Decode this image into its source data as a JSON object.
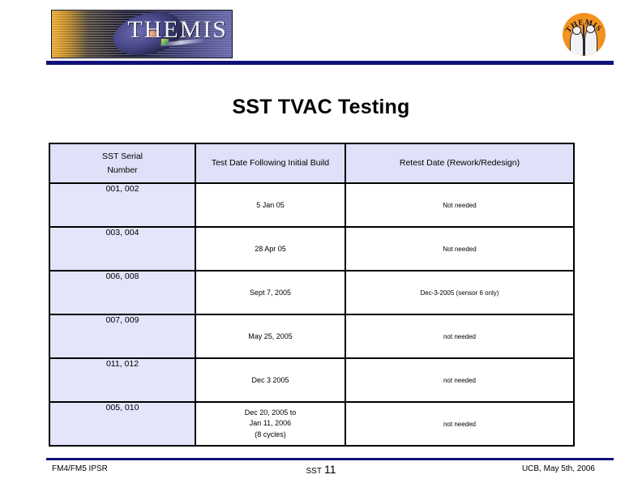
{
  "header": {
    "banner_wordmark": "THEMIS",
    "seal_text": "THEMIS"
  },
  "title": "SST TVAC Testing",
  "table": {
    "columns": [
      "SST Serial\nNumber",
      "Test Date Following Initial Build",
      "Retest Date (Rework/Redesign)"
    ],
    "header_serial_line1": "SST Serial",
    "header_serial_line2": "Number",
    "header_test": "Test Date Following Initial Build",
    "header_retest": "Retest Date (Rework/Redesign)",
    "rows": [
      {
        "serial": "001, 002",
        "test_date": "5 Jan 05",
        "retest_date": "Not needed"
      },
      {
        "serial": "003, 004",
        "test_date": "28 Apr 05",
        "retest_date": "Not needed"
      },
      {
        "serial": "006, 008",
        "test_date": "Sept 7,  2005",
        "retest_date": "Dec-3-2005 (sensor 6 only)"
      },
      {
        "serial": "007, 009",
        "test_date": "May 25, 2005",
        "retest_date": "not needed"
      },
      {
        "serial": "011, 012",
        "test_date": "Dec 3 2005",
        "retest_date": "not needed"
      },
      {
        "serial": "005, 010",
        "test_date_line1": "Dec 20, 2005 to",
        "test_date_line2": "Jan 11, 2006",
        "test_date_line3": "(8 cycles)",
        "retest_date": "not needed"
      }
    ]
  },
  "footer": {
    "left": "FM4/FM5 IPSR",
    "center_label": "SST",
    "page_number": "11",
    "right": "UCB, May 5th, 2006"
  },
  "colors": {
    "rule_navy": "#10107a",
    "table_header_fill": "#e0e0f8",
    "serial_cell_fill": "#e4e4fb",
    "seal_orange": "#f2901c"
  }
}
